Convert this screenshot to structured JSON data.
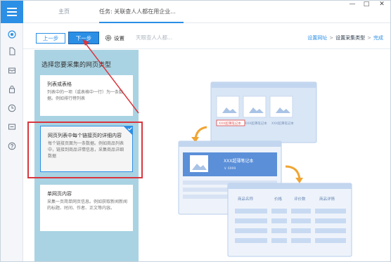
{
  "tabs": {
    "home": "主页",
    "task": "任务: 关联查人人都在用企业..."
  },
  "window_controls": [
    "—",
    "□",
    "✕"
  ],
  "toolbar": {
    "prev_label": "上一步",
    "next_label": "下一步",
    "settings_label": "设置",
    "task_name_placeholder": "天眼查人人都..."
  },
  "steps": {
    "step1": "设置网址",
    "step2": "设置采集类型",
    "step3": "完成",
    "separator": ">"
  },
  "panel": {
    "title": "选择您要采集的网页类型",
    "cards": [
      {
        "title": "列表或表格",
        "desc": "列表中的一项（或表格中一行）为一条数据。例如排行榜列表"
      },
      {
        "title": "网页列表中每个链接页的详细内容",
        "desc": "每个链接页面为一条数据。例如商品列表中，链接到商品详情信息，采集商品详细数据"
      },
      {
        "title": "单网页内容",
        "desc": "采集一页简单网页信息。例如获取新闻新闻的标题、时间、作者、正文等内容。"
      }
    ]
  },
  "illustration": {
    "items": [
      "XXX超薄笔记本",
      "XXX超薄笔记本",
      "XXX超薄笔记本"
    ],
    "detail_title": "XXX超薄笔记本",
    "detail_price": "￥ 6999",
    "table_headers": [
      "商品名称",
      "价格",
      "评价数",
      "商品详情"
    ]
  },
  "colors": {
    "accent": "#2b8fe6",
    "panel_bg": "#a9d3e3",
    "highlight": "#d9363e",
    "arrow": "#f0a533"
  }
}
